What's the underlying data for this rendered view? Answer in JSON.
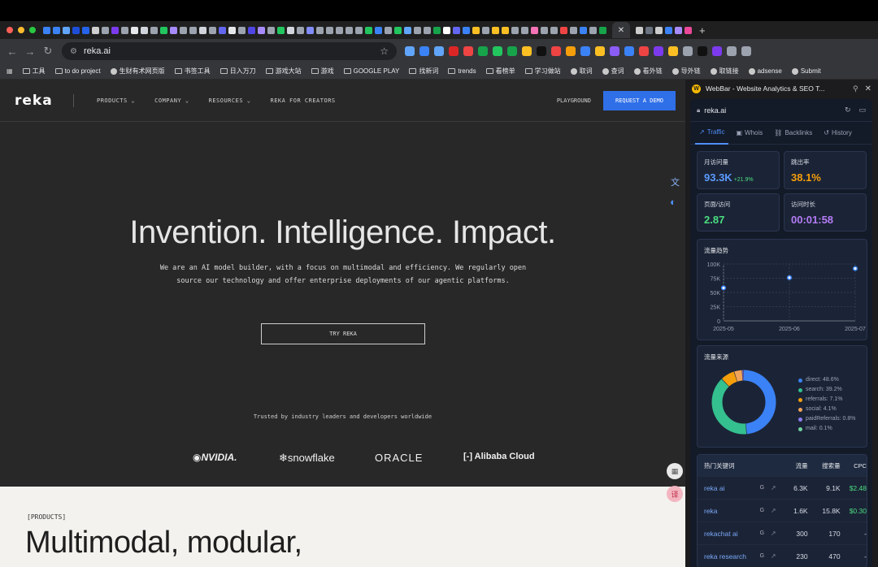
{
  "browser": {
    "url": "reka.ai",
    "bookmarks": [
      "工具",
      "to do project",
      "生财有术网页版",
      "书签工具",
      "日入万刀",
      "游戏大站",
      "游戏",
      "GOOGLE PLAY",
      "找新词",
      "trends",
      "看榜单",
      "学习做站",
      "取词",
      "查词",
      "看外链",
      "导外链",
      "取链接",
      "adsense",
      "Submit"
    ]
  },
  "site": {
    "logo": "reka",
    "nav": [
      "PRODUCTS",
      "COMPANY",
      "RESOURCES",
      "REKA FOR CREATORS"
    ],
    "playground": "PLAYGROUND",
    "demo_button": "REQUEST A DEMO",
    "hero_title": "Invention. Intelligence. Impact.",
    "hero_sub_1": "We are an AI model builder, with a focus on multimodal and efficiency. We regularly open",
    "hero_sub_2": "source our technology and offer enterprise deployments of our agentic platforms.",
    "try_button": "TRY REKA",
    "trusted": "Trusted by industry leaders and developers worldwide",
    "partners": [
      "NVIDIA.",
      "snowflake",
      "ORACLE",
      "Alibaba Cloud"
    ],
    "products_tag": "[PRODUCTS]",
    "products_title": "Multimodal, modular,"
  },
  "panel": {
    "title": "WebBar - Website Analytics & SEO T...",
    "domain": "reka.ai",
    "tabs": [
      "Traffic",
      "Whois",
      "Backlinks",
      "History"
    ],
    "stats": {
      "visits_label": "月访问量",
      "visits": "93.3K",
      "visits_delta": "+21.9%",
      "bounce_label": "跳出率",
      "bounce": "38.1%",
      "pages_label": "页面/访问",
      "pages": "2.87",
      "duration_label": "访问时长",
      "duration": "00:01:58"
    },
    "trend_title": "流量趋势",
    "sources_title": "流量来源",
    "keywords": {
      "title": "热门关键词",
      "cols": [
        "流量",
        "搜索量",
        "CPC"
      ],
      "rows": [
        {
          "kw": "reka ai",
          "traffic": "6.3K",
          "volume": "9.1K",
          "cpc": "$2.48"
        },
        {
          "kw": "reka",
          "traffic": "1.6K",
          "volume": "15.8K",
          "cpc": "$0.30"
        },
        {
          "kw": "rekachat ai",
          "traffic": "300",
          "volume": "170",
          "cpc": "-"
        },
        {
          "kw": "reka research",
          "traffic": "230",
          "volume": "470",
          "cpc": "-"
        }
      ]
    }
  },
  "chart_data": [
    {
      "type": "line",
      "title": "流量趋势",
      "x": [
        "2025-05",
        "2025-06",
        "2025-07"
      ],
      "series": [
        {
          "values": [
            58000,
            76000,
            92000
          ]
        }
      ],
      "yticks": [
        "100K",
        "75K",
        "50K",
        "25K",
        "0"
      ],
      "ylim": [
        0,
        100000
      ]
    },
    {
      "type": "pie",
      "title": "流量来源",
      "labels": [
        "direct: 48.6%",
        "search: 39.2%",
        "referrals: 7.1%",
        "social: 4.1%",
        "paidReferrals: 0.8%",
        "mail: 0.1%"
      ],
      "values": [
        48.6,
        39.2,
        7.1,
        4.1,
        0.8,
        0.1
      ],
      "colors": [
        "#3b82f6",
        "#34c08f",
        "#f59e0b",
        "#f0a35a",
        "#8b7cf6",
        "#6fd3a0"
      ]
    }
  ]
}
